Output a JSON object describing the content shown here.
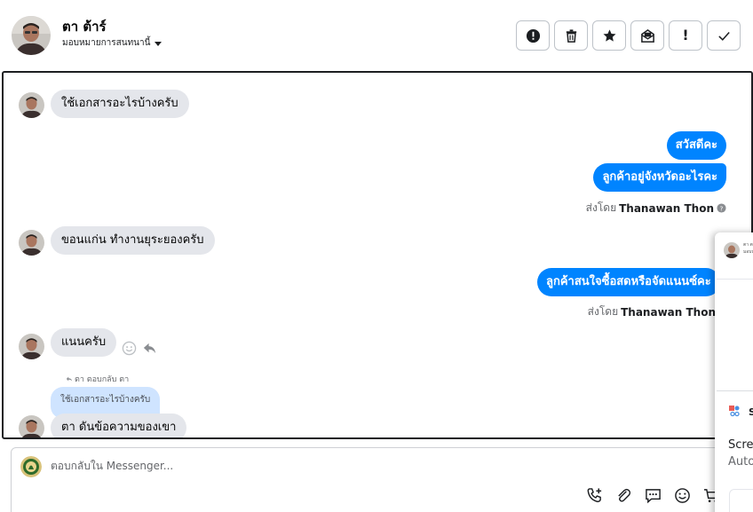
{
  "header": {
    "contact_name": "ตา ต้าร์",
    "assign_label": "มอบหมายการสนทนานี้",
    "actions": [
      {
        "name": "mark-spam-button",
        "icon": "alert-circle-icon"
      },
      {
        "name": "delete-button",
        "icon": "trash-icon"
      },
      {
        "name": "star-button",
        "icon": "star-icon"
      },
      {
        "name": "mark-unread-button",
        "icon": "envelope-open-icon"
      },
      {
        "name": "follow-up-button",
        "icon": "exclamation-icon",
        "glyph": "!"
      },
      {
        "name": "done-button",
        "icon": "check-icon"
      }
    ]
  },
  "messages": [
    {
      "id": "m1",
      "direction": "in",
      "text": "ใช้เอกสารอะไรบ้างครับ"
    },
    {
      "id": "m2",
      "direction": "out",
      "text": "สวัสดีคะ"
    },
    {
      "id": "m3",
      "direction": "out",
      "text": "ลูกค้าอยู่จังหวัดอะไรคะ"
    },
    {
      "id": "m4",
      "direction": "in",
      "text": "ขอนแก่น ทำงานยุระยองครับ"
    },
    {
      "id": "m5",
      "direction": "out",
      "text": "ลูกค้าสนใจซื้อสดหรือจัดแนนซ์คะ"
    },
    {
      "id": "m6",
      "direction": "in",
      "text": "แนนครับ"
    },
    {
      "id": "m7",
      "direction": "in",
      "text": "ตา ดันข้อความของเขา",
      "reply_label": "ตา ตอบกลับ ตา",
      "quoted_text": "ใช้เอกสารอะไรบ้างครับ"
    }
  ],
  "sent_by": {
    "prefix": "ส่งโดย",
    "agent_name": "Thanawan Thon"
  },
  "side_panel": {
    "title_fragment": "ตา ต",
    "subtitle_fragment": "มอบห",
    "section_label_fragment": "S",
    "line1_fragment": "Scre",
    "line2_fragment": "Auto"
  },
  "composer": {
    "placeholder": "ตอบกลับใน Messenger...",
    "tools": [
      "call-add-icon",
      "attachment-icon",
      "saved-reply-icon",
      "emoji-icon",
      "cart-add-icon"
    ]
  },
  "colors": {
    "outgoing_bubble": "#0084ff",
    "incoming_bubble": "#e4e6eb",
    "quoted_bubble": "#cfe4ff"
  }
}
